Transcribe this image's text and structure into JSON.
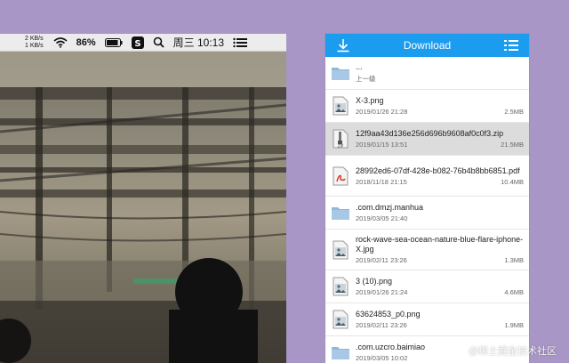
{
  "menubar": {
    "net_up": "2 KB/s",
    "net_down": "1 KB/s",
    "battery_percent": "86%",
    "clock": "周三 10:13"
  },
  "panel": {
    "title": "Download",
    "accent": "#1c9cee",
    "files": [
      {
        "name": "...",
        "subtitle": "上一级",
        "date": "",
        "size": "",
        "type": "folder",
        "selected": false
      },
      {
        "name": "X-3.png",
        "subtitle": "",
        "date": "2019/01/26 21:28",
        "size": "2.5MB",
        "type": "image",
        "selected": false
      },
      {
        "name": "12f9aa43d136e256d696b9608af0c0f3.zip",
        "subtitle": "",
        "date": "2019/01/15 13:51",
        "size": "21.5MB",
        "type": "zip",
        "selected": true
      },
      {
        "name": "28992ed6-07df-428e-b082-76b4b8bb6851.pdf",
        "subtitle": "",
        "date": "2018/11/18 21:15",
        "size": "10.4MB",
        "type": "pdf",
        "selected": false
      },
      {
        "name": ".com.dmzj.manhua",
        "subtitle": "",
        "date": "2019/03/05 21:40",
        "size": "",
        "type": "folder",
        "selected": false
      },
      {
        "name": "rock-wave-sea-ocean-nature-blue-flare-iphone-X.jpg",
        "subtitle": "",
        "date": "2019/02/11 23:26",
        "size": "1.3MB",
        "type": "image",
        "selected": false
      },
      {
        "name": "3 (10).png",
        "subtitle": "",
        "date": "2019/01/26 21:24",
        "size": "4.6MB",
        "type": "image",
        "selected": false
      },
      {
        "name": "63624853_p0.png",
        "subtitle": "",
        "date": "2019/02/11 23:26",
        "size": "1.9MB",
        "type": "image",
        "selected": false
      },
      {
        "name": ".com.uzcro.baimiao",
        "subtitle": "",
        "date": "2019/03/05 10:02",
        "size": "",
        "type": "folder",
        "selected": false
      }
    ]
  },
  "watermark": "@稀土掘金技术社区"
}
